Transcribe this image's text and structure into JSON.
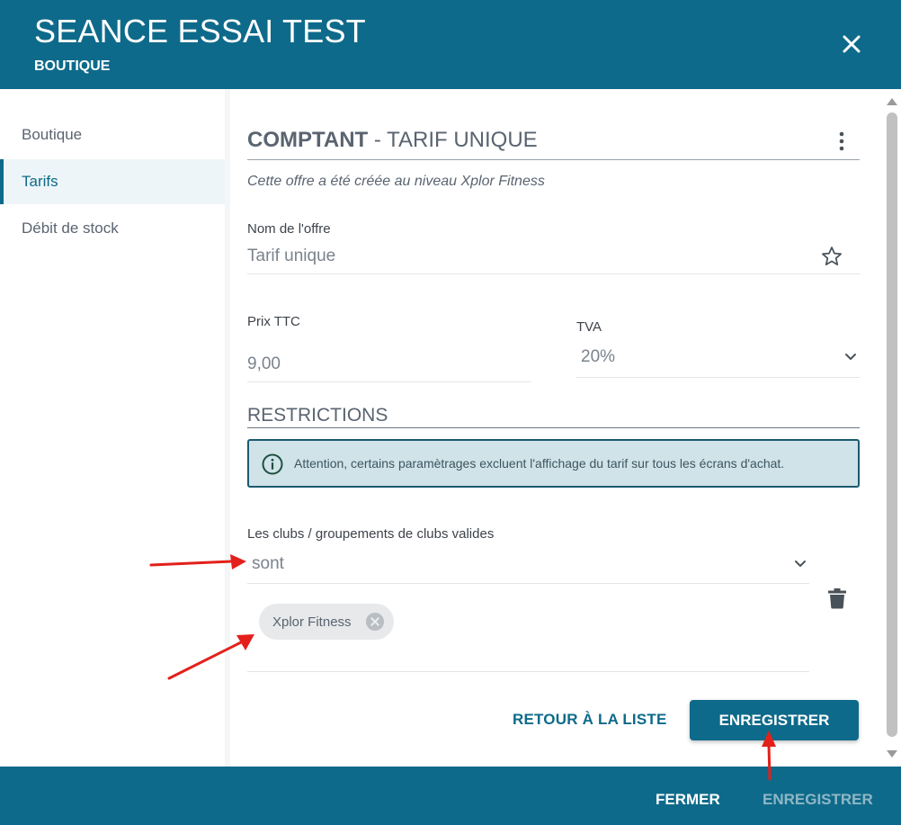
{
  "header": {
    "title": "SEANCE ESSAI TEST",
    "subtitle": "BOUTIQUE"
  },
  "sidebar": {
    "items": [
      {
        "label": "Boutique",
        "active": false
      },
      {
        "label": "Tarifs",
        "active": true
      },
      {
        "label": "Débit de stock",
        "active": false
      }
    ]
  },
  "offer": {
    "heading_strong": "COMPTANT",
    "heading_sep": " - ",
    "heading_light": "TARIF UNIQUE",
    "note": "Cette offre a été créée au niveau Xplor Fitness",
    "name_label": "Nom de l'offre",
    "name_value": "Tarif unique",
    "price_label": "Prix TTC",
    "price_value": "9,00",
    "vat_label": "TVA",
    "vat_value": "20%"
  },
  "restrictions": {
    "heading": "RESTRICTIONS",
    "alert_text": "Attention, certains paramètrages excluent l'affichage du tarif sur tous les écrans d'achat.",
    "clubs_label": "Les clubs / groupements de clubs valides",
    "clubs_operator": "sont",
    "clubs_selected": [
      "Xplor Fitness"
    ]
  },
  "actions": {
    "back_label": "RETOUR À LA LISTE",
    "save_label": "ENREGISTRER"
  },
  "footer": {
    "close_label": "FERMER",
    "save_label": "ENREGISTRER"
  },
  "colors": {
    "primary": "#0e6a8a",
    "alert_bg": "#cfe3e8",
    "alert_border": "#1c5a6f",
    "annotation_arrow": "#e3201b"
  }
}
